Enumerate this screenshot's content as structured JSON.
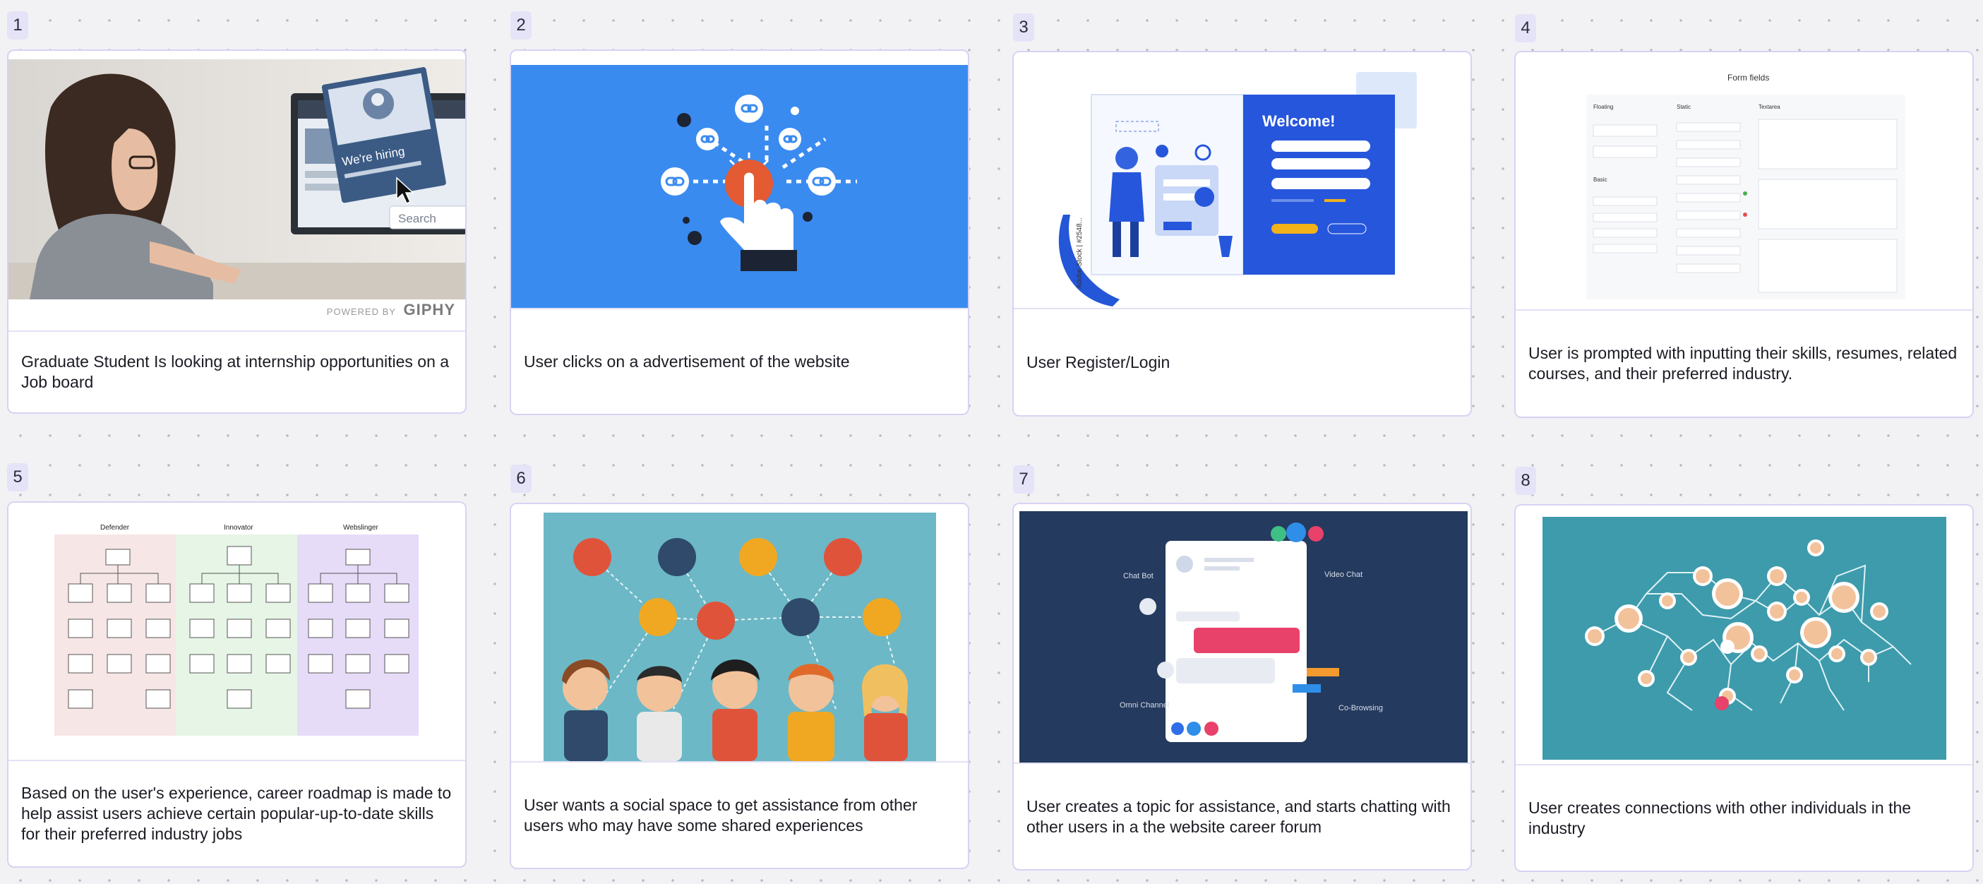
{
  "cards": [
    {
      "number": "1",
      "caption": "Graduate Student Is looking at internship opportunities on a Job board",
      "image": "woman-at-computer-job-board-photo",
      "giphy": "GIPHY",
      "powered_by": "POWERED BY",
      "hiring_text": "We're hiring",
      "search_text": "Search"
    },
    {
      "number": "2",
      "caption": "User clicks on a advertisement of the website",
      "image": "hand-clicking-link-illustration"
    },
    {
      "number": "3",
      "caption": "User Register/Login",
      "image": "login-screen-illustration",
      "welcome": "Welcome!",
      "adobe_stock": "Adobe Stock | #2548..."
    },
    {
      "number": "4",
      "caption": "User is prompted with inputting their skills, resumes, related courses, and their preferred industry.",
      "image": "form-fields-mockup",
      "form_title": "Form fields",
      "col_floating": "Floating",
      "col_static": "Static",
      "col_textarea": "Textarea",
      "col_basic": "Basic"
    },
    {
      "number": "5",
      "caption": "Based on the user's experience, career roadmap is made to help assist users achieve certain popular-up-to-date skills for their preferred industry jobs",
      "image": "career-roadmap-chart",
      "col_defender": "Defender",
      "col_innovator": "Innovator",
      "col_webslinger": "Webslinger"
    },
    {
      "number": "6",
      "caption": "User wants a social space to get assistance from other users who may have some shared experiences",
      "image": "social-network-people-illustration"
    },
    {
      "number": "7",
      "caption": "User creates a topic for assistance, and starts chatting with other users in a the website career forum",
      "image": "chat-forum-illustration",
      "chat_bot": "Chat Bot",
      "video_chat": "Video Chat",
      "omni_channel": "Omni Channel",
      "co_browsing": "Co-Browsing"
    },
    {
      "number": "8",
      "caption": "User creates connections with other individuals in the industry",
      "image": "world-network-connections-illustration"
    }
  ]
}
